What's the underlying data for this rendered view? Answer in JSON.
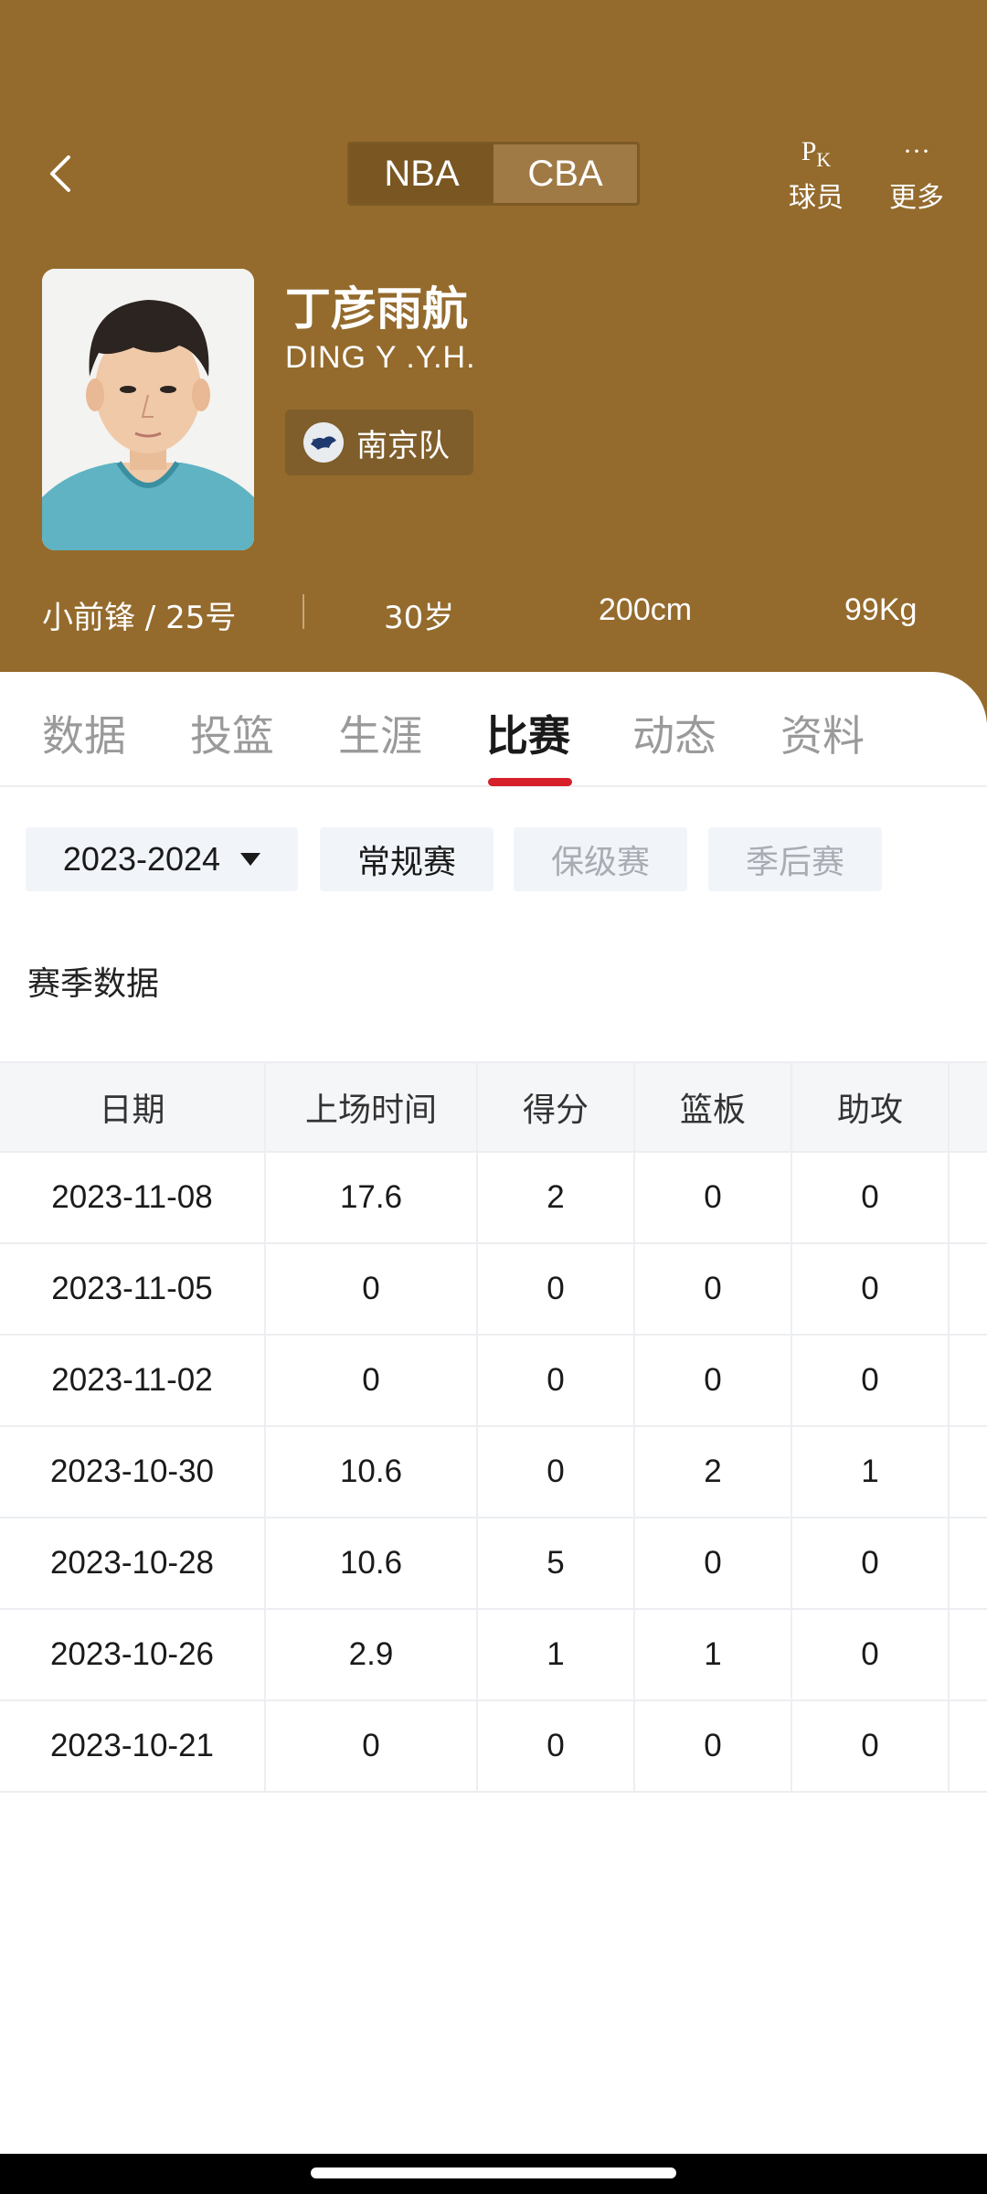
{
  "header": {
    "leagues": [
      "NBA",
      "CBA"
    ],
    "active_league": "CBA",
    "pk_icon": "PK",
    "pk_label": "球员",
    "more_icon": "···",
    "more_label": "更多",
    "background_color": "#946b2d"
  },
  "player": {
    "name": "丁彦雨航",
    "english_name": "DING Y .Y.H.",
    "team": "南京队",
    "position": "小前锋 / 25号",
    "age": "30岁",
    "height": "200cm",
    "weight": "99Kg"
  },
  "tabs": [
    {
      "label": "数据",
      "active": false
    },
    {
      "label": "投篮",
      "active": false
    },
    {
      "label": "生涯",
      "active": false
    },
    {
      "label": "比赛",
      "active": true
    },
    {
      "label": "动态",
      "active": false
    },
    {
      "label": "资料",
      "active": false
    }
  ],
  "filters": {
    "season": "2023-2024",
    "types": [
      {
        "label": "常规赛",
        "active": true
      },
      {
        "label": "保级赛",
        "active": false
      },
      {
        "label": "季后赛",
        "active": false
      }
    ]
  },
  "section_title": "赛季数据",
  "table": {
    "columns": [
      "日期",
      "上场时间",
      "得分",
      "篮板",
      "助攻"
    ],
    "rows": [
      [
        "2023-11-08",
        "17.6",
        "2",
        "0",
        "0"
      ],
      [
        "2023-11-05",
        "0",
        "0",
        "0",
        "0"
      ],
      [
        "2023-11-02",
        "0",
        "0",
        "0",
        "0"
      ],
      [
        "2023-10-30",
        "10.6",
        "0",
        "2",
        "1"
      ],
      [
        "2023-10-28",
        "10.6",
        "5",
        "0",
        "0"
      ],
      [
        "2023-10-26",
        "2.9",
        "1",
        "1",
        "0"
      ],
      [
        "2023-10-21",
        "0",
        "0",
        "0",
        "0"
      ]
    ]
  },
  "colors": {
    "accent": "#d6202a",
    "header_bg": "#946b2d",
    "filter_bg": "#f1f4f9"
  }
}
